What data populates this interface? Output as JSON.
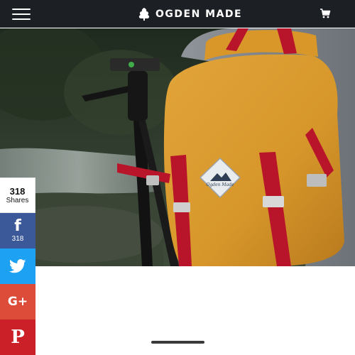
{
  "header": {
    "brand_name": "OGDEN MADE",
    "logo_icon": "tree-icon",
    "menu_icon": "hamburger-menu-icon",
    "cart_icon": "shopping-cart-icon",
    "background": "#1c1f24"
  },
  "hero": {
    "image": "yellow-backpack-with-tripod-photo",
    "patch_text": "Ogden Made"
  },
  "share": {
    "total_count": "318",
    "total_label": "Shares",
    "facebook": {
      "icon": "facebook-icon",
      "glyph": "f",
      "count": "318",
      "color": "#3b5998"
    },
    "twitter": {
      "icon": "twitter-bird-icon",
      "color": "#1da1f2"
    },
    "google_plus": {
      "icon": "google-plus-icon",
      "glyph": "G+",
      "color": "#dd4b39"
    },
    "pinterest": {
      "icon": "pinterest-icon",
      "glyph": "P",
      "color": "#cb2027"
    }
  }
}
